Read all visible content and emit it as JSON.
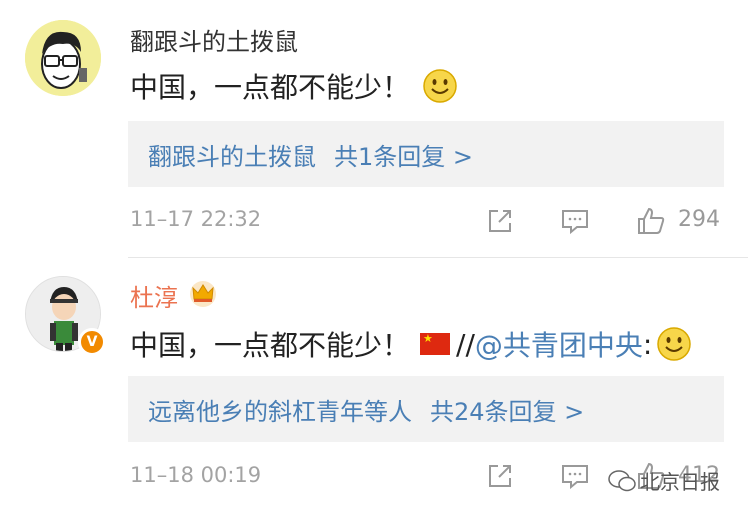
{
  "comments": [
    {
      "username": "翻跟斗的土拨鼠",
      "text": "中国，一点都不能少！",
      "reply_preview": "翻跟斗的土拨鼠",
      "reply_count": "共1条回复 >",
      "timestamp": "11–17 22:32",
      "likes": "294",
      "icons": [
        "avatar-cartoon",
        "smiley-emoji",
        "share-icon",
        "comment-icon",
        "like-icon"
      ]
    },
    {
      "username": "杜淳",
      "text": "中国，一点都不能少！",
      "repost_sep": "//",
      "mention": "@共青团中央",
      "colon": ":",
      "reply_preview": "远离他乡的斜杠青年等人",
      "reply_count": "共24条回复 >",
      "timestamp": "11–18 00:19",
      "likes": "412",
      "verified_badge": "V",
      "icons": [
        "avatar-photo",
        "crown-icon",
        "china-flag-emoji",
        "smiley-emoji",
        "share-icon",
        "comment-icon",
        "like-icon"
      ]
    }
  ],
  "watermark": "北京日报",
  "colors": {
    "link": "#4a7fb5",
    "vip_name": "#eb7350",
    "meta": "#a3a3a3",
    "reply_bg": "#f2f2f2"
  }
}
